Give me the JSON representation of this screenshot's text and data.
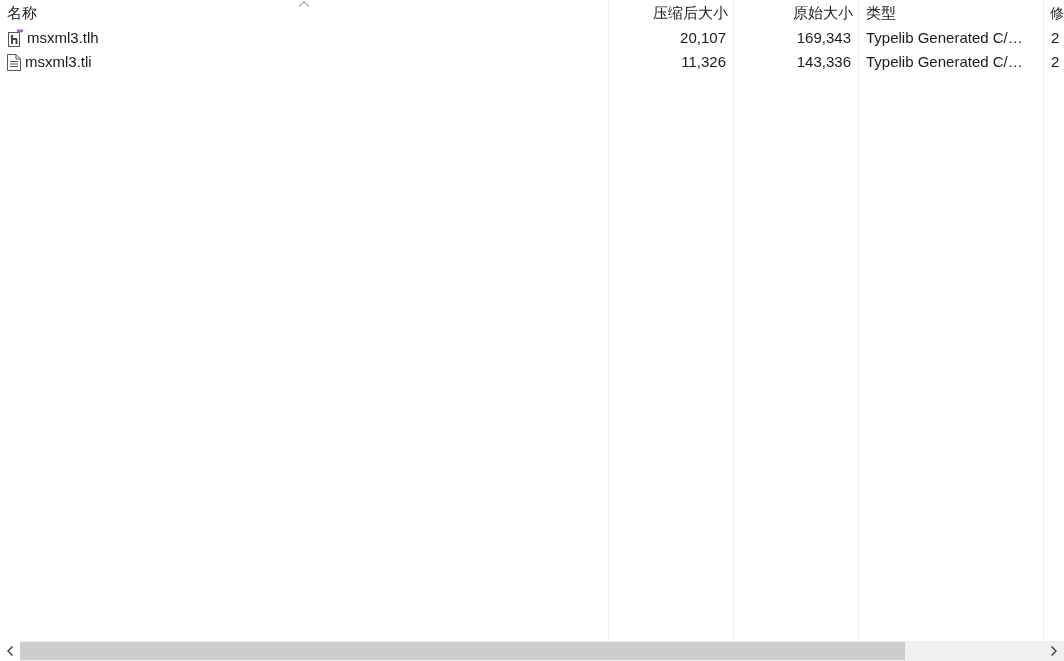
{
  "columns": [
    {
      "label": "名称",
      "sorted": true
    },
    {
      "label": "压缩后大小",
      "sorted": false
    },
    {
      "label": "原始大小",
      "sorted": false
    },
    {
      "label": "类型",
      "sorted": false
    },
    {
      "label": "修",
      "sorted": false
    }
  ],
  "rows": [
    {
      "kind": "header",
      "selected": false,
      "cells": [
        "msxml3.tlh",
        "20,107",
        "169,343",
        "Typelib Generated C/…",
        "2"
      ]
    },
    {
      "kind": "text",
      "selected": false,
      "cells": [
        "msxml3.tli",
        "11,326",
        "143,336",
        "Typelib Generated C/…",
        "2"
      ]
    }
  ]
}
